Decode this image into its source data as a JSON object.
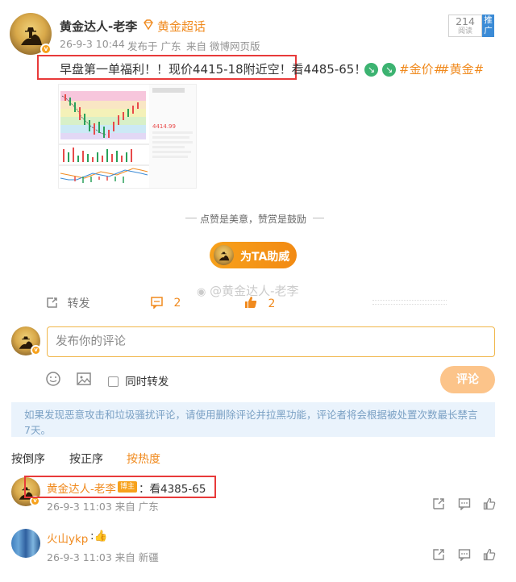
{
  "post": {
    "author": "黄金达人-老李",
    "vip_label": "黄金超话",
    "meta_time": "26-9-3 10:44",
    "meta_from": "发布于 广东",
    "meta_source": "来自 微博网页版",
    "read_count": "214",
    "read_label": "阅读",
    "promote_label": "推广",
    "text": "早盘第一单福利！！现价4415-18附近空！看4485-65！",
    "hashtag1": "#金价#",
    "hashtag2": "#黄金#",
    "chart_price": "4414.99",
    "reward_caption": "点赞是美意，赞赏是鼓励",
    "support_button": "为TA助威",
    "watermark": "@黄金达人-老李",
    "repost_label": "转发",
    "comment_count": "2",
    "like_count": "2"
  },
  "composer": {
    "placeholder": "发布你的评论",
    "also_repost": "同时转发",
    "submit": "评论"
  },
  "notice": "如果发现恶意攻击和垃圾骚扰评论，请使用删除评论并拉黑功能，评论者将会根据被处置次数最长禁言7天。",
  "sort_tabs": [
    "按倒序",
    "按正序",
    "按热度"
  ],
  "comments": [
    {
      "name": "黄金达人-老李",
      "badge": "博主",
      "text": "：看4385-65",
      "meta": "26-9-3 11:03 来自 广东"
    },
    {
      "name": "火山ykp",
      "text": ":👍",
      "meta": "26-9-3 11:03 来自 新疆"
    }
  ]
}
